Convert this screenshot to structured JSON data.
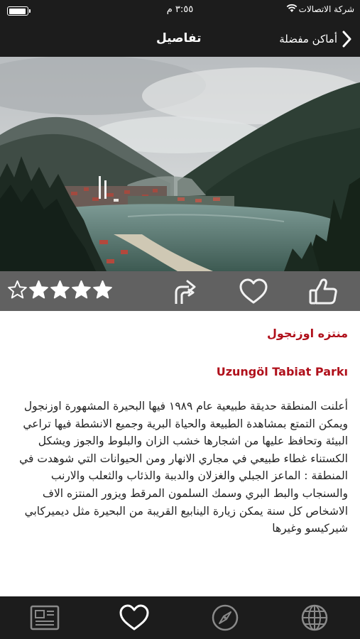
{
  "status_bar": {
    "carrier": "شركة الاتصالات",
    "time": "٣:٥٥ م",
    "battery_level": 0.95
  },
  "nav": {
    "title": "تفاصيل",
    "back_label": "أماكن مفضلة"
  },
  "rating": {
    "filled": 4,
    "total": 5
  },
  "place": {
    "name_ar": "منتزه اوزنجول",
    "name_latin": "Uzungöl Tabiat Parkı",
    "description": "أعلنت المنطقة حديقة طبيعية عام ١٩٨٩ فيها البحيرة المشهورة اوزنجول ويمكن التمتع بمشاهدة الطبيعة والحياة البرية وجميع الانشطة فيها تراعي البيئة وتحافظ عليها من اشجارها خشب الزان والبلوط والجوز ويشكل الكستناء غطاء طبيعي في مجاري الانهار ومن الحيوانات التي شوهدت في المنطقة : الماعز الجبلي والغزلان والدببة والذئاب والثعلب والارنب والسنجاب والبط البري وسمك السلمون المرقط ويزور المنتزه الاف الاشخاص كل سنة يمكن زيارة الينابيع القريبة من البحيرة مثل ديميركابي شيركيسو وغيرها"
  },
  "icons": {
    "action_bar": [
      "star-icon",
      "directions-icon",
      "heart-icon",
      "thumbs-up-icon"
    ],
    "tab_bar": [
      "news-icon",
      "favorites-heart-icon",
      "compass-icon",
      "globe-icon"
    ]
  },
  "colors": {
    "bar_background": "#1c1c1c",
    "action_bar_background": "#616161",
    "accent_red": "#b0101b"
  }
}
